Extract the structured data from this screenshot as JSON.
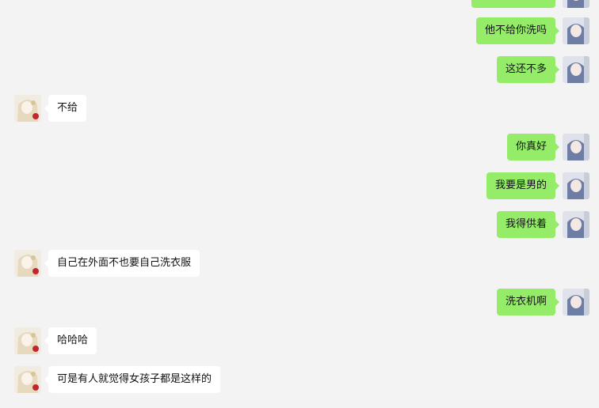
{
  "chat": {
    "messages": [
      {
        "side": "right",
        "text": ""
      },
      {
        "side": "right",
        "text": "他不给你洗吗"
      },
      {
        "side": "right",
        "text": "这还不多"
      },
      {
        "side": "left",
        "text": "不给"
      },
      {
        "side": "right",
        "text": "你真好"
      },
      {
        "side": "right",
        "text": "我要是男的"
      },
      {
        "side": "right",
        "text": "我得供着"
      },
      {
        "side": "left",
        "text": "自己在外面不也要自己洗衣服"
      },
      {
        "side": "right",
        "text": "洗衣机啊"
      },
      {
        "side": "left",
        "text": "哈哈哈"
      },
      {
        "side": "left",
        "text": "可是有人就觉得女孩子都是这样的"
      }
    ]
  },
  "colors": {
    "background": "#f3f3f3",
    "sent_bubble": "#95ec69",
    "received_bubble": "#ffffff"
  }
}
